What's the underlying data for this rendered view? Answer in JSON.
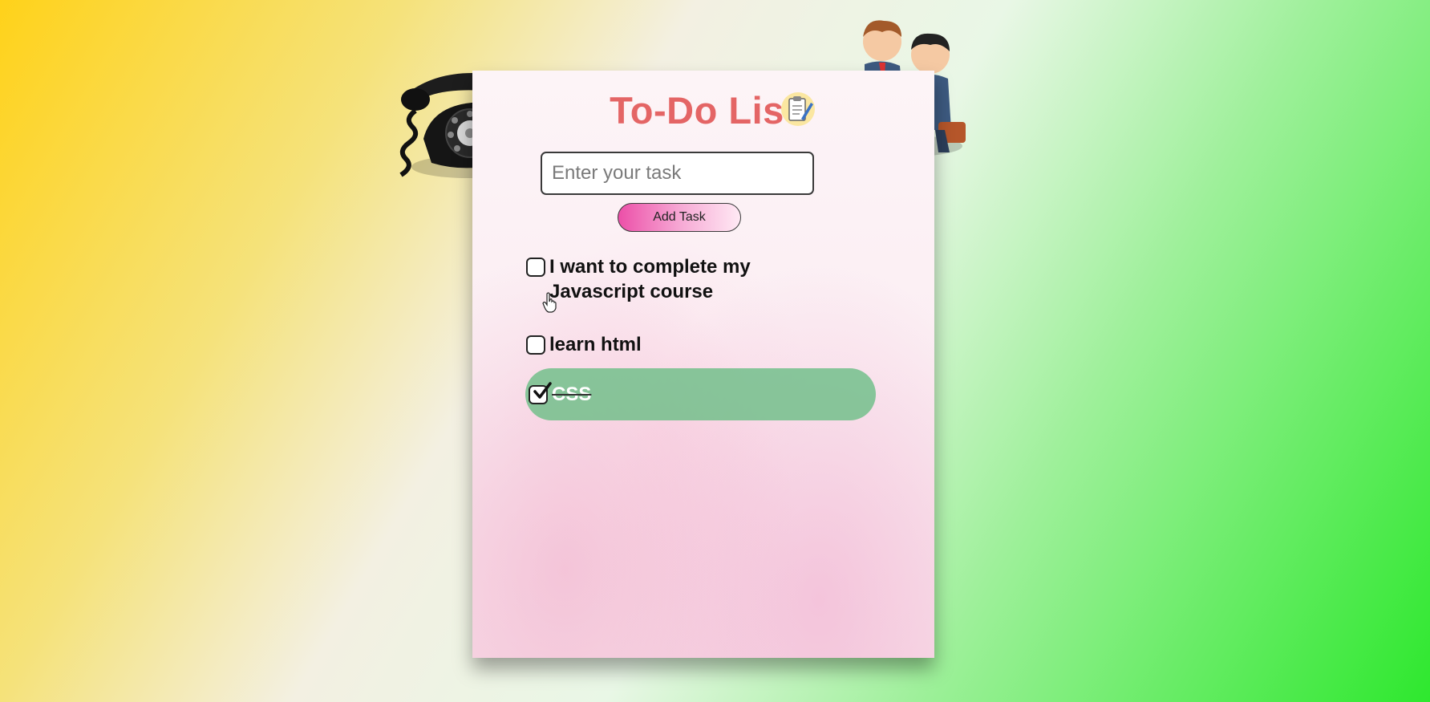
{
  "app": {
    "title": "To-Do List"
  },
  "input": {
    "placeholder": "Enter your task",
    "value": ""
  },
  "add_button": {
    "label": "Add Task"
  },
  "tasks": [
    {
      "text": "I want to complete my Javascript course",
      "done": false
    },
    {
      "text": "learn html",
      "done": false
    },
    {
      "text": "CSS",
      "done": true
    }
  ],
  "icons": {
    "title_icon": "clipboard-checklist-icon",
    "decoration_left": "rotary-telephone-icon",
    "decoration_right": "businessmen-handshake-icon",
    "cursor": "hand-pointer-icon"
  },
  "colors": {
    "title": "#e46565",
    "completed_task_bg": "#6ebe87",
    "button_gradient_start": "#ec4fa8"
  }
}
